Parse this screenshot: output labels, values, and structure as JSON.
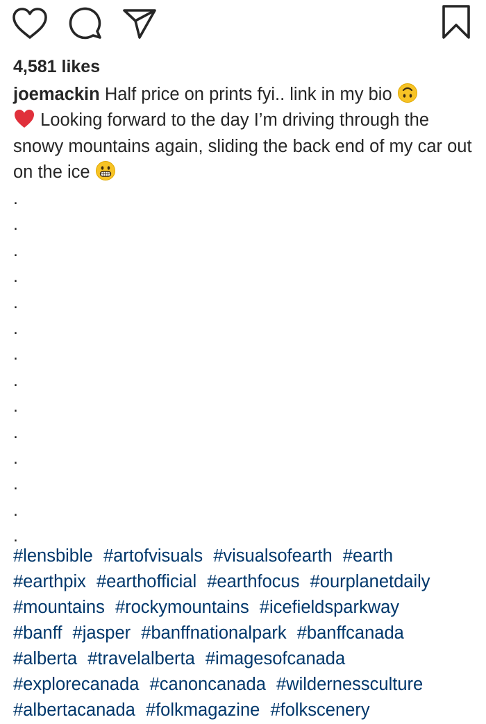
{
  "actions": {
    "like_icon": "heart-outline-icon",
    "comment_icon": "speech-bubble-icon",
    "share_icon": "paper-plane-icon",
    "save_icon": "bookmark-outline-icon"
  },
  "likes_text": "4,581 likes",
  "caption": {
    "username": "joemackin",
    "line1_text": "Half price on prints fyi.. link in my bio",
    "emoji1": "upside-down-face-emoji",
    "emoji2": "red-heart-emoji",
    "text2": "Looking forward to the day I’m driving through the snowy mountains again, sliding the back end of my car out on the ice",
    "emoji3": "grimacing-face-emoji",
    "dots": [
      ".",
      ".",
      ".",
      ".",
      ".",
      ".",
      ".",
      ".",
      ".",
      ".",
      ".",
      ".",
      ".",
      "."
    ]
  },
  "hashtags": [
    "#lensbible",
    "#artofvisuals",
    "#visualsofearth",
    "#earth",
    "#earthpix",
    "#earthofficial",
    "#earthfocus",
    "#ourplanetdaily",
    "#mountains",
    "#rockymountains",
    "#icefieldsparkway",
    "#banff",
    "#jasper",
    "#banffnationalpark",
    "#banffcanada",
    "#alberta",
    "#travelalberta",
    "#imagesofcanada",
    "#explorecanada",
    "#canoncanada",
    "#wildernessculture",
    "#albertacanada",
    "#folkmagazine",
    "#folkscenery"
  ],
  "colors": {
    "text": "#262626",
    "hashtag": "#00376b",
    "heart_emoji": "#e0303b",
    "face_emoji": "#f7c325"
  }
}
